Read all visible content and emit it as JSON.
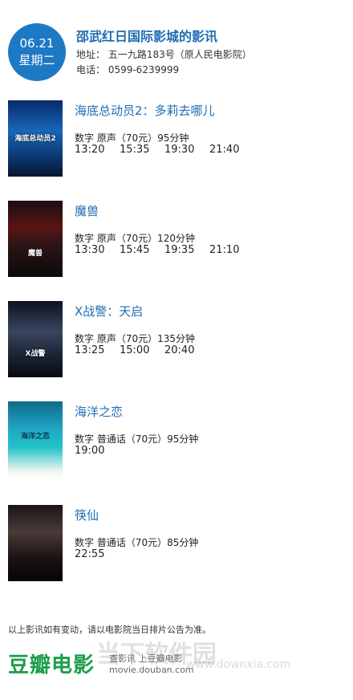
{
  "header": {
    "date": "06.21",
    "weekday": "星期二",
    "cinema_name": "邵武红日国际影城的影讯",
    "address": "地址：  五一九路183号（原人民电影院）",
    "phone": "电话：  0599-6239999"
  },
  "movies": [
    {
      "title": "海底总动员2：多莉去哪儿",
      "poster_text": "海底总动员2",
      "info": "数字  原声（70元）95分钟",
      "times": [
        "13:20",
        "15:35",
        "19:30",
        "21:40"
      ]
    },
    {
      "title": "魔兽",
      "poster_text": "魔兽",
      "info": "数字  原声（70元）120分钟",
      "times": [
        "13:30",
        "15:45",
        "19:35",
        "21:10"
      ]
    },
    {
      "title": "X战警：天启",
      "poster_text": "X战警",
      "info": "数字  原声（70元）135分钟",
      "times": [
        "13:25",
        "15:00",
        "20:40"
      ]
    },
    {
      "title": "海洋之恋",
      "poster_text": "海洋之恋",
      "info": "数字  普通话（70元）95分钟",
      "times": [
        "19:00"
      ]
    },
    {
      "title": "筷仙",
      "poster_text": "",
      "info": "数字  普通话（70元）85分钟",
      "times": [
        "22:55"
      ]
    }
  ],
  "footer": {
    "disclaimer": "以上影讯如有变动，请以电影院当日排片公告为准。",
    "logo_text": "豆瓣电影",
    "logo_sub1": "查影讯  上豆瓣电影",
    "logo_sub2": "movie.douban.com",
    "watermark": "当下软件园",
    "watermark_sub": "www.downxia.com"
  },
  "colors": {
    "accent": "#1e79c4",
    "title_blue": "#1e6db3",
    "douban_green": "#1b9e4b"
  }
}
